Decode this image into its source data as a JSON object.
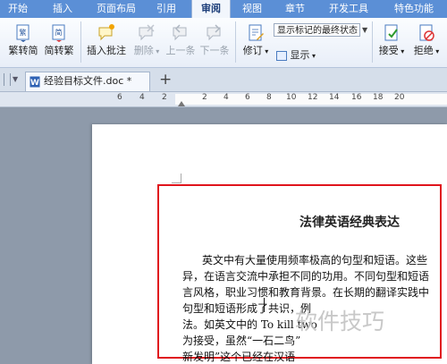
{
  "menu": [
    "开始",
    "插入",
    "页面布局",
    "引用",
    "审阅",
    "视图",
    "章节",
    "开发工具",
    "特色功能"
  ],
  "menu_active": "审阅",
  "ribbon": {
    "trad_to_simp": "繁转简",
    "simp_to_trad": "简转繁",
    "insert_comment": "插入批注",
    "delete": "删除",
    "prev": "上一条",
    "next": "下一条",
    "track_changes": "修订",
    "markup_state": "显示标记的最终状态",
    "show": "显示",
    "accept": "接受",
    "reject": "拒绝"
  },
  "tab_label": "经验目标文件.doc *",
  "tab_plus": "+",
  "ruler_numbers": [
    "6",
    "4",
    "2",
    "2",
    "4",
    "6",
    "8",
    "10",
    "12",
    "14",
    "16",
    "18",
    "20"
  ],
  "document": {
    "title": "法律英语经典表达",
    "lines": [
      "英文中有大量使用频率极高的句型和短语。这些",
      "异，在语言交流中承担不同的功用。不同句型和短语",
      "言风格，职业习惯和教育背景。在长期的翻译实践中",
      "句型和短语形成了共识，例",
      "法。如英文中的 To kill two",
      "为接受，虽然“一石二鸟”",
      "新发明”这个已经在汉语"
    ]
  },
  "watermark": "软件技巧"
}
